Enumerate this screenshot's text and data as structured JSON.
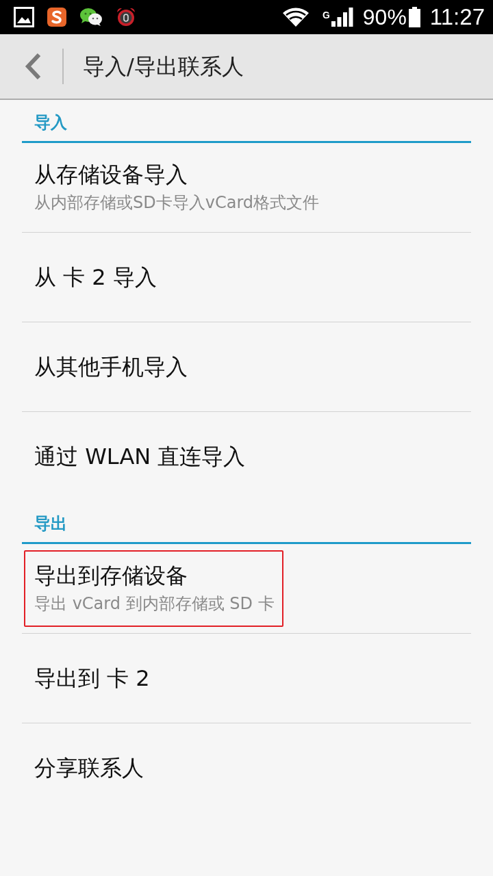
{
  "status_bar": {
    "network": "G",
    "battery": "90%",
    "time": "11:27"
  },
  "toolbar": {
    "title": "导入/导出联系人"
  },
  "sections": [
    {
      "title": "导入",
      "items": [
        {
          "title": "从存储设备导入",
          "subtitle": "从内部存储或SD卡导入vCard格式文件",
          "highlighted": false
        },
        {
          "title": "从 卡 2 导入",
          "highlighted": false
        },
        {
          "title": "从其他手机导入",
          "highlighted": false
        },
        {
          "title": "通过 WLAN 直连导入",
          "highlighted": false
        }
      ]
    },
    {
      "title": "导出",
      "items": [
        {
          "title": "导出到存储设备",
          "subtitle": "导出 vCard 到内部存储或 SD 卡",
          "highlighted": true
        },
        {
          "title": "导出到 卡 2",
          "highlighted": false
        },
        {
          "title": "分享联系人",
          "highlighted": false
        }
      ]
    }
  ]
}
